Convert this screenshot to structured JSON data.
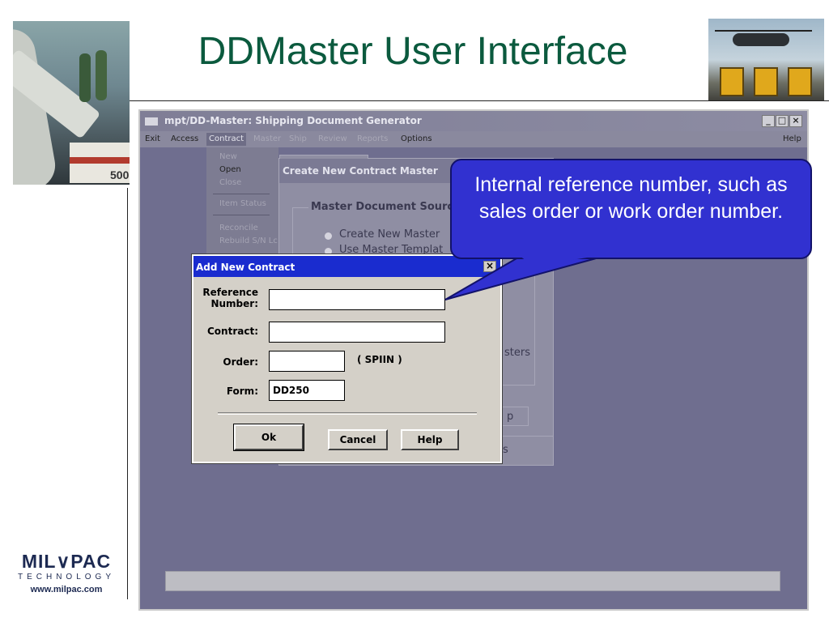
{
  "slide": {
    "title": "DDMaster User Interface",
    "logo": {
      "brand": "MIL∨PAC",
      "tagline": "TECHNOLOGY",
      "url": "www.milpac.com"
    },
    "photo_left_number": "500"
  },
  "app": {
    "title": "mpt/DD-Master: Shipping Document Generator",
    "window_buttons": {
      "minimize": "_",
      "maximize": "□",
      "close": "×"
    },
    "menu": {
      "exit": "Exit",
      "access": "Access",
      "contract": "Contract",
      "master": "Master",
      "ship": "Ship",
      "review": "Review",
      "reports": "Reports",
      "options": "Options",
      "help": "Help"
    },
    "contract_menu": {
      "new": "New",
      "open": "Open",
      "close": "Close",
      "item_status": "Item Status",
      "reconcile": "Reconcile",
      "rebuild": "Rebuild S/N Lc"
    }
  },
  "background_dialog": {
    "title": "Create New Contract Master",
    "group_label": "Master Document Source",
    "option_create": "Create New Master",
    "option_template": "Use Master Templat",
    "partial_text": "sters",
    "partial_button": "p",
    "partial_footer": "s"
  },
  "dialog": {
    "title": "Add New Contract",
    "close_label": "×",
    "reference_label_1": "Reference",
    "reference_label_2": "Number:",
    "reference_value": "",
    "contract_label": "Contract:",
    "contract_value": "",
    "order_label": "Order:",
    "order_value": "",
    "order_hint": "( SPIIN )",
    "form_label": "Form:",
    "form_value": "DD250",
    "ok_label": "Ok",
    "cancel_label": "Cancel",
    "help_label": "Help"
  },
  "callout": {
    "text": "Internal reference number, such as sales order or work order number."
  },
  "colors": {
    "title_green": "#0b5a3e",
    "app_background": "#6f6e8f",
    "dialog_titlebar": "#1a2ccf",
    "callout_fill": "#3131d0"
  }
}
